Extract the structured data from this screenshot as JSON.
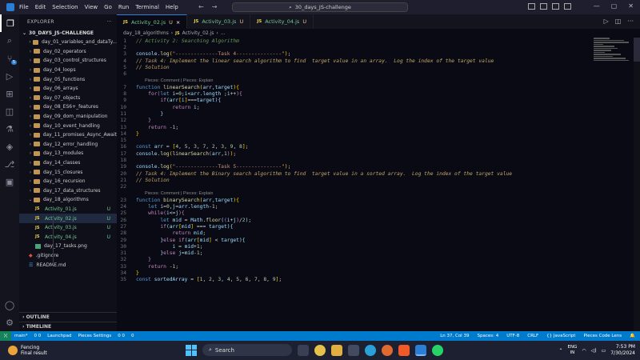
{
  "titlebar": {
    "menu": [
      "File",
      "Edit",
      "Selection",
      "View",
      "Go",
      "Run",
      "Terminal",
      "Help"
    ],
    "search": "30_days_JS-challenge"
  },
  "sidebar": {
    "header": "EXPLORER",
    "header_more": "···",
    "project": "30_DAYS_JS-CHALLENGE",
    "items": [
      {
        "label": "day_01_variables_and_dataTy...",
        "type": "folder"
      },
      {
        "label": "day_02_operators",
        "type": "folder"
      },
      {
        "label": "day_03_control_structures",
        "type": "folder"
      },
      {
        "label": "day_04_loops",
        "type": "folder"
      },
      {
        "label": "day_05_functions",
        "type": "folder"
      },
      {
        "label": "day_06_arrays",
        "type": "folder"
      },
      {
        "label": "day_07_objects",
        "type": "folder"
      },
      {
        "label": "day_08_ES6+_features",
        "type": "folder"
      },
      {
        "label": "day_09_dom_manipulation",
        "type": "folder"
      },
      {
        "label": "day_10_event_handling",
        "type": "folder"
      },
      {
        "label": "day_11_promises_Async_Await",
        "type": "folder"
      },
      {
        "label": "day_12_error_handling",
        "type": "folder"
      },
      {
        "label": "day_13_modules",
        "type": "folder"
      },
      {
        "label": "day_14_classes",
        "type": "folder"
      },
      {
        "label": "day_15_closures",
        "type": "folder"
      },
      {
        "label": "day_16_recursion",
        "type": "folder"
      },
      {
        "label": "day_17_data_structures",
        "type": "folder"
      },
      {
        "label": "day_18_algorithms",
        "type": "folder-open"
      },
      {
        "label": "Activity_01.js",
        "type": "js",
        "status": "U"
      },
      {
        "label": "Activity_02.js",
        "type": "js",
        "status": "U"
      },
      {
        "label": "Activity_03.js",
        "type": "js",
        "status": "U"
      },
      {
        "label": "Activity_04.js",
        "type": "js",
        "status": "U"
      },
      {
        "label": "day_17_tasks.png",
        "type": "img"
      },
      {
        "label": ".gitignore",
        "type": "git"
      },
      {
        "label": "README.md",
        "type": "md"
      }
    ],
    "outline": "OUTLINE",
    "timeline": "TIMELINE"
  },
  "tabs": [
    {
      "label": "Activity_02.js",
      "status": "U",
      "close": "×",
      "active": true
    },
    {
      "label": "Activity_03.js",
      "status": "U"
    },
    {
      "label": "Activity_04.js",
      "status": "U"
    }
  ],
  "breadcrumb": {
    "folder": "day_18_algorithms",
    "file": "Activity_02.js",
    "tail": "..."
  },
  "codelens": "Pieces: Comment | Pieces: Explain",
  "statusbar": {
    "left": [
      "main*",
      "0  0",
      "Launchpad",
      "Pieces Settings",
      "0  0",
      "0"
    ],
    "right": [
      "Ln 37, Col 39",
      "Spaces: 4",
      "UTF-8",
      "CRLF",
      "{} JavaScript",
      "Pieces Code Lens"
    ]
  },
  "taskbar": {
    "weather_title": "Fencing",
    "weather_sub": "Final result",
    "search": "Search",
    "lang1": "ENG",
    "lang2": "IN",
    "time": "7:53 PM",
    "date": "7/30/2024"
  },
  "colors": {
    "accent": "#007acc",
    "untracked": "#73c991",
    "js_icon": "#e8d44d"
  }
}
